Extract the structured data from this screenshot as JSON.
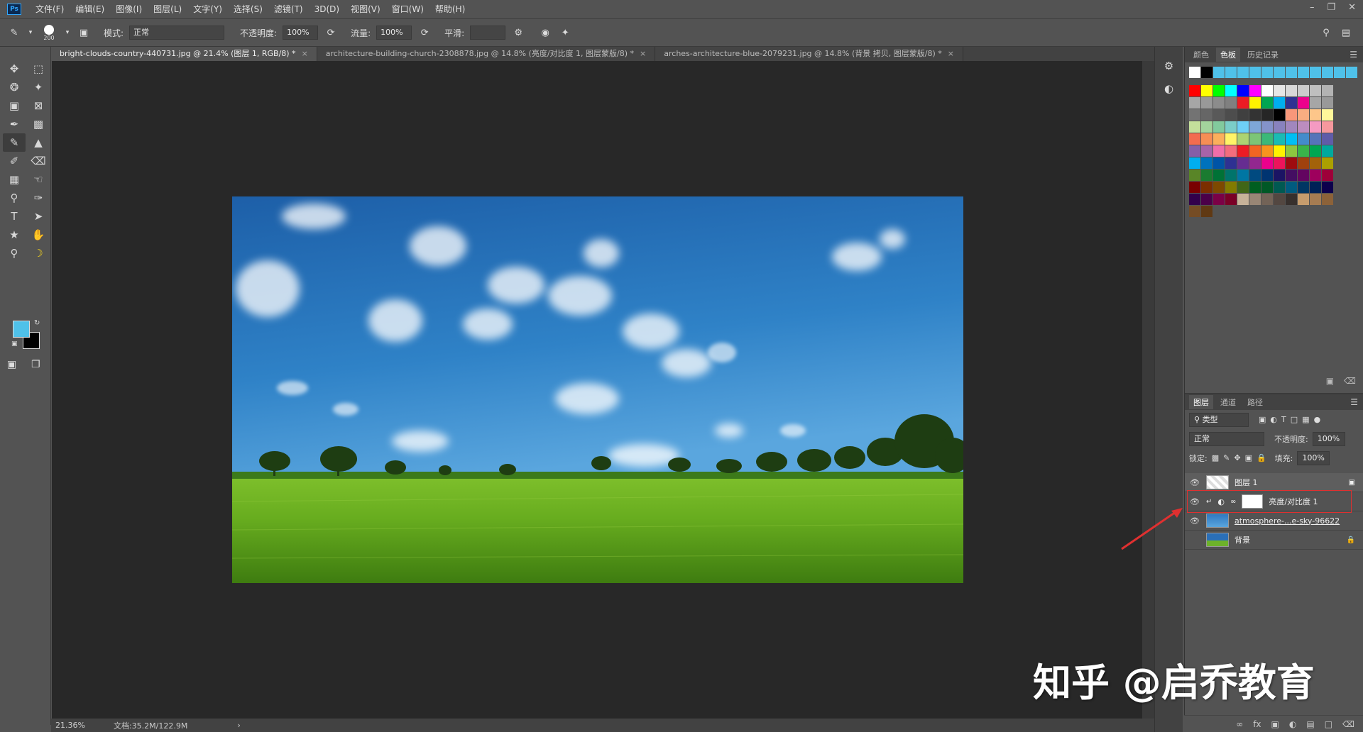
{
  "app": {
    "logo": "Ps"
  },
  "menu": [
    "文件(F)",
    "编辑(E)",
    "图像(I)",
    "图层(L)",
    "文字(Y)",
    "选择(S)",
    "滤镜(T)",
    "3D(D)",
    "视图(V)",
    "窗口(W)",
    "帮助(H)"
  ],
  "options": {
    "brush_size": "200",
    "mode_label": "模式:",
    "mode_value": "正常",
    "opacity_label": "不透明度:",
    "opacity_value": "100%",
    "flow_label": "流量:",
    "flow_value": "100%",
    "smooth_label": "平滑:",
    "smooth_value": ""
  },
  "tabs": [
    {
      "label": "bright-clouds-country-440731.jpg @ 21.4% (图层 1, RGB/8) *",
      "active": true
    },
    {
      "label": "architecture-building-church-2308878.jpg @ 14.8% (亮度/对比度 1, 图层蒙版/8) *",
      "active": false
    },
    {
      "label": "arches-architecture-blue-2079231.jpg @ 14.8% (背景 拷贝, 图层蒙版/8) *",
      "active": false
    }
  ],
  "status": {
    "zoom": "21.36%",
    "doc": "文档:35.2M/122.9M"
  },
  "colors": {
    "foreground": "#4fc1e9",
    "background": "#000000",
    "highlight": "#e03030"
  },
  "swatch_panel": {
    "tabs": [
      "颜色",
      "色板",
      "历史记录"
    ],
    "active": "色板"
  },
  "layers_panel": {
    "tabs": [
      "图层",
      "通道",
      "路径"
    ],
    "filter_label": "类型",
    "blend_mode": "正常",
    "opacity_label": "不透明度:",
    "opacity_value": "100%",
    "lock_label": "锁定:",
    "fill_label": "填充:",
    "fill_value": "100%",
    "layers": [
      {
        "name": "图层 1",
        "selected": true
      },
      {
        "name": "亮度/对比度 1",
        "selected": false
      },
      {
        "name": "atmosphere-...e-sky-96622",
        "selected": false
      },
      {
        "name": "背景",
        "selected": false
      }
    ]
  },
  "watermark": "知乎 @启乔教育"
}
